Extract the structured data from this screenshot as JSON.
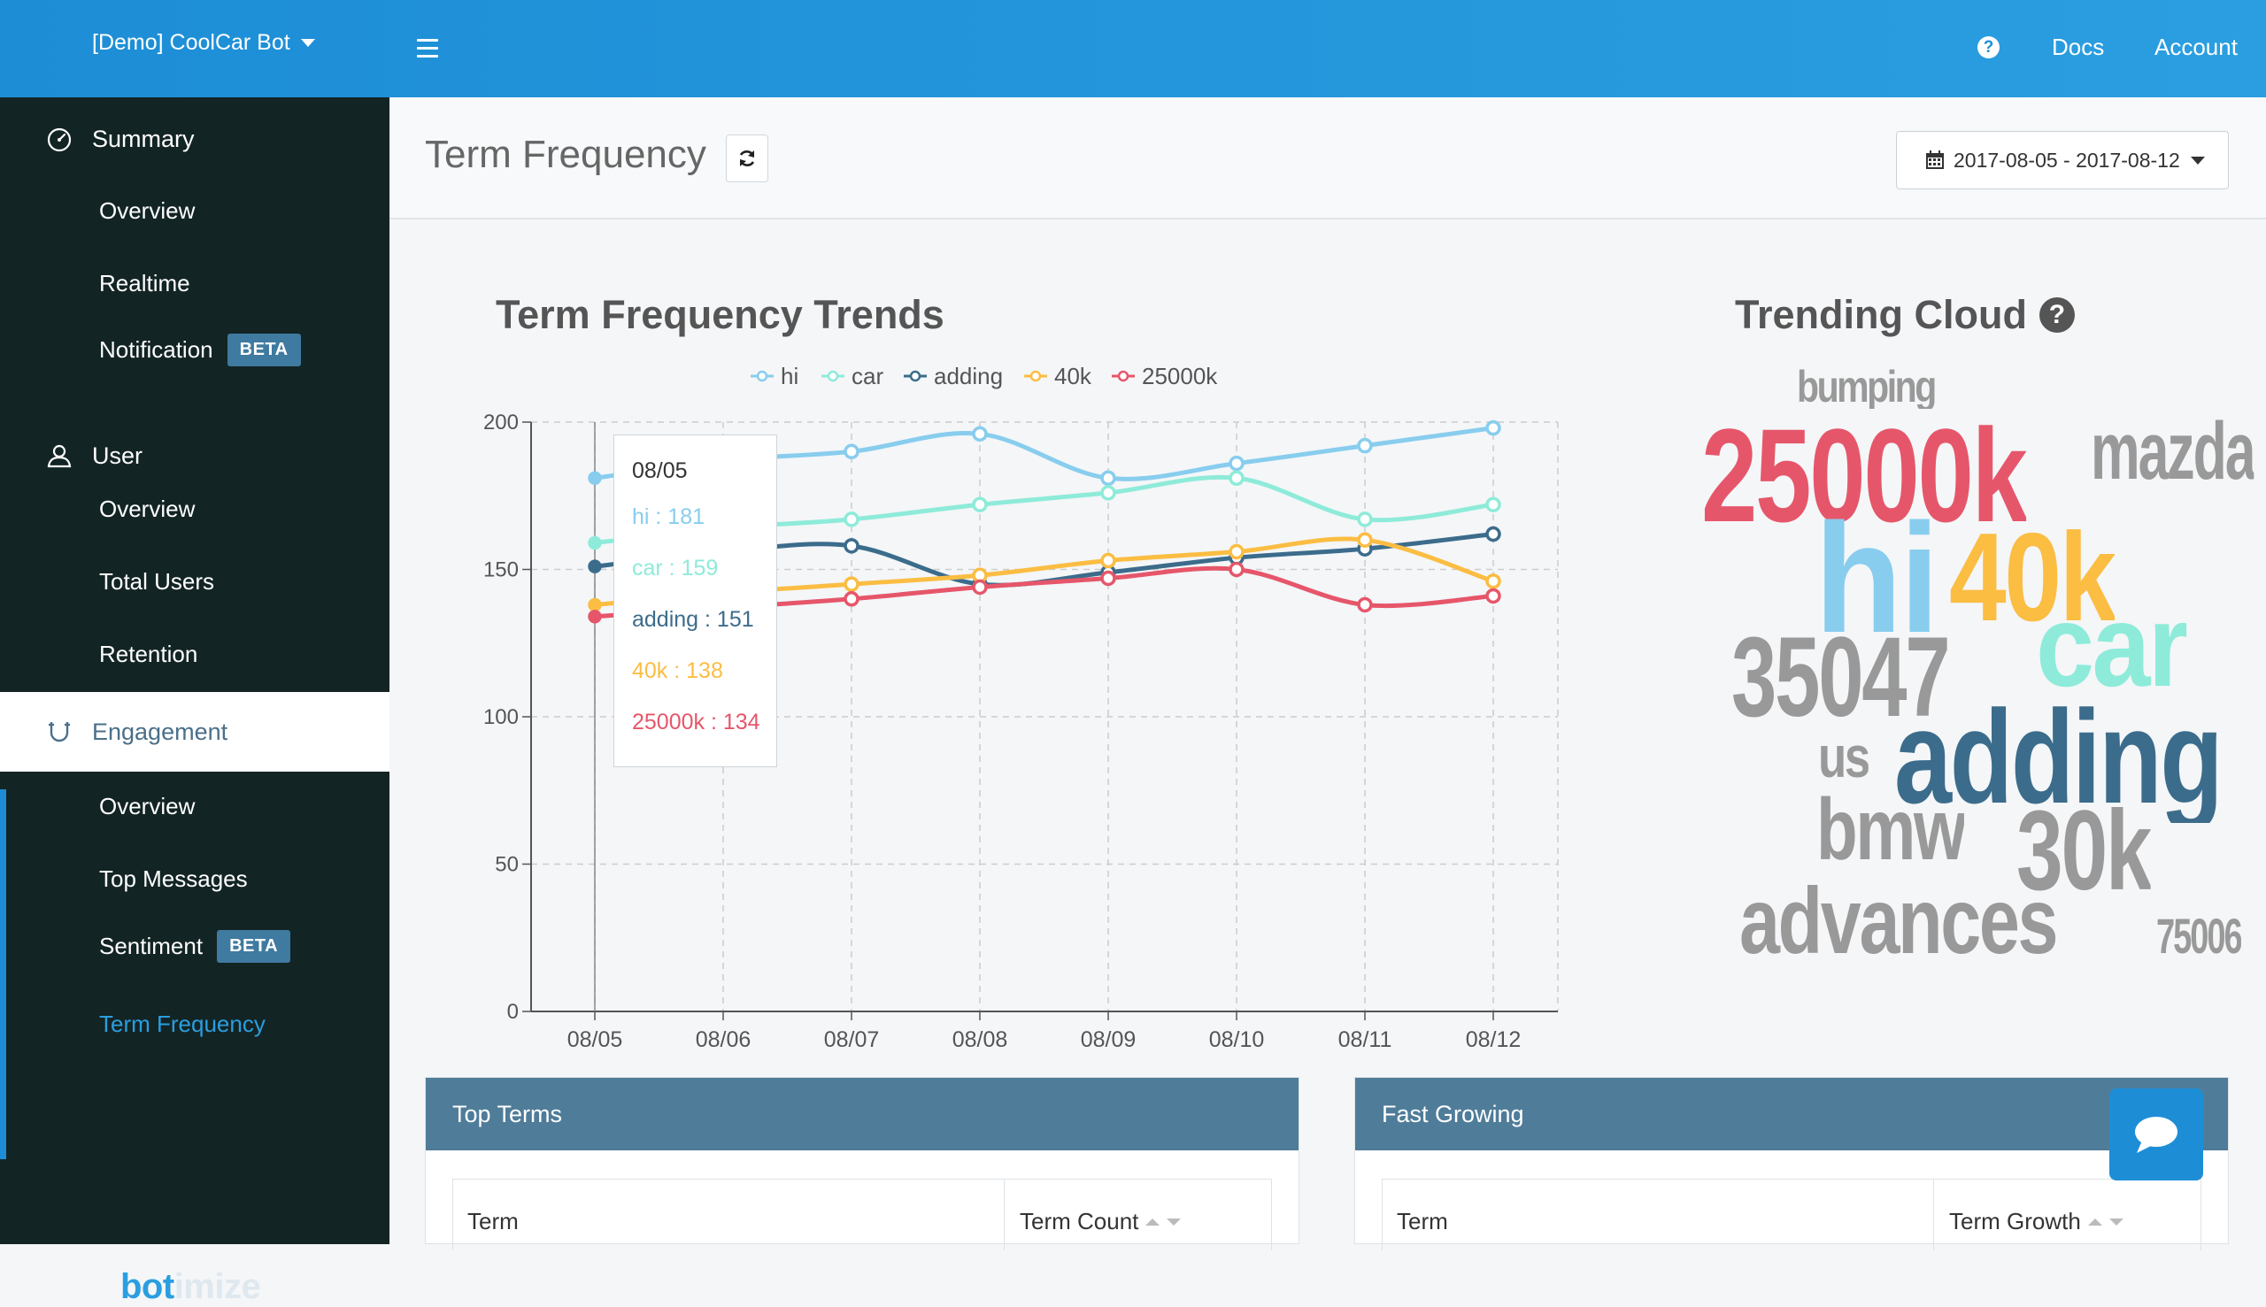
{
  "topbar": {
    "bot_name": "[Demo] CoolCar Bot",
    "help": "?",
    "docs": "Docs",
    "account": "Account"
  },
  "sidebar": {
    "summary": "Summary",
    "summary_overview": "Overview",
    "realtime": "Realtime",
    "notification": "Notification",
    "notification_badge": "BETA",
    "user": "User",
    "user_overview": "Overview",
    "total_users": "Total Users",
    "retention": "Retention",
    "engagement": "Engagement",
    "eng_overview": "Overview",
    "top_messages": "Top Messages",
    "sentiment": "Sentiment",
    "sentiment_badge": "BETA",
    "term_frequency": "Term Frequency",
    "logo_a": "bot",
    "logo_b": "imize"
  },
  "page": {
    "title": "Term Frequency",
    "date_range": "2017-08-05 - 2017-08-12"
  },
  "chart_data": {
    "type": "line",
    "title": "Term Frequency Trends",
    "categories": [
      "08/05",
      "08/06",
      "08/07",
      "08/08",
      "08/09",
      "08/10",
      "08/11",
      "08/12"
    ],
    "ylim": [
      0,
      200
    ],
    "yticks": [
      0,
      50,
      100,
      150,
      200
    ],
    "grid": true,
    "legend_position": "top",
    "series": [
      {
        "name": "hi",
        "color": "#88cdee",
        "values": [
          181,
          187,
          190,
          196,
          181,
          186,
          192,
          198
        ]
      },
      {
        "name": "car",
        "color": "#8eebd9",
        "values": [
          159,
          164,
          167,
          172,
          176,
          181,
          167,
          172
        ]
      },
      {
        "name": "adding",
        "color": "#3c6c8b",
        "values": [
          151,
          156,
          158,
          145,
          149,
          154,
          157,
          162
        ]
      },
      {
        "name": "40k",
        "color": "#fbbd42",
        "values": [
          138,
          142,
          145,
          148,
          153,
          156,
          160,
          146
        ]
      },
      {
        "name": "25000k",
        "color": "#e6566a",
        "values": [
          134,
          137,
          140,
          144,
          147,
          150,
          138,
          141
        ]
      }
    ],
    "tooltip": {
      "date": "08/05",
      "rows": [
        "hi : 181",
        "car : 159",
        "adding : 151",
        "40k : 138",
        "25000k : 134"
      ]
    }
  },
  "cloud": {
    "title": "Trending Cloud",
    "help": "?",
    "words": [
      {
        "text": "bumping",
        "color": "#999999"
      },
      {
        "text": "25000k",
        "color": "#e6566a"
      },
      {
        "text": "mazda",
        "color": "#999999"
      },
      {
        "text": "hi",
        "color": "#88cdee"
      },
      {
        "text": "40k",
        "color": "#fbbd42"
      },
      {
        "text": "car",
        "color": "#8eebd9"
      },
      {
        "text": "35047",
        "color": "#999999"
      },
      {
        "text": "us",
        "color": "#999999"
      },
      {
        "text": "adding",
        "color": "#3c6c8b"
      },
      {
        "text": "bmw",
        "color": "#999999"
      },
      {
        "text": "30k",
        "color": "#999999"
      },
      {
        "text": "advances",
        "color": "#999999"
      },
      {
        "text": "75006",
        "color": "#999999"
      }
    ]
  },
  "panels": {
    "top_terms": {
      "title": "Top Terms",
      "col1": "Term",
      "col2": "Term Count"
    },
    "fast_growing": {
      "title": "Fast Growing",
      "col1": "Term",
      "col2": "Term Growth"
    }
  }
}
